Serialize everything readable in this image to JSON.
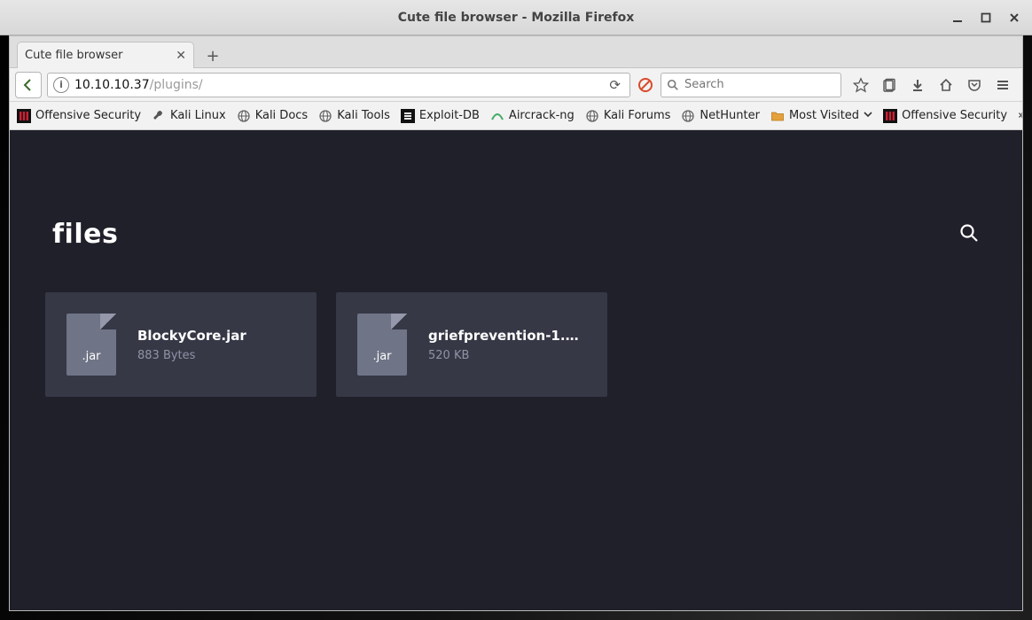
{
  "window": {
    "title": "Cute file browser - Mozilla Firefox"
  },
  "tab": {
    "title": "Cute file browser"
  },
  "url": {
    "dark": "10.10.10.37",
    "light": "/plugins/"
  },
  "search": {
    "placeholder": "Search"
  },
  "bookmarks": [
    {
      "icon": "kali",
      "label": "Offensive Security"
    },
    {
      "icon": "wrench",
      "label": "Kali Linux"
    },
    {
      "icon": "globe",
      "label": "Kali Docs"
    },
    {
      "icon": "globe",
      "label": "Kali Tools"
    },
    {
      "icon": "db",
      "label": "Exploit-DB"
    },
    {
      "icon": "air",
      "label": "Aircrack-ng"
    },
    {
      "icon": "globe",
      "label": "Kali Forums"
    },
    {
      "icon": "globe",
      "label": "NetHunter"
    },
    {
      "icon": "folder",
      "label": "Most Visited",
      "chevron": true
    },
    {
      "icon": "kali",
      "label": "Offensive Security"
    }
  ],
  "page": {
    "title": "files"
  },
  "files": [
    {
      "ext": ".jar",
      "name": "BlockyCore.jar",
      "size": "883 Bytes"
    },
    {
      "ext": ".jar",
      "name": "griefprevention-1.1…",
      "size": "520 KB"
    }
  ]
}
